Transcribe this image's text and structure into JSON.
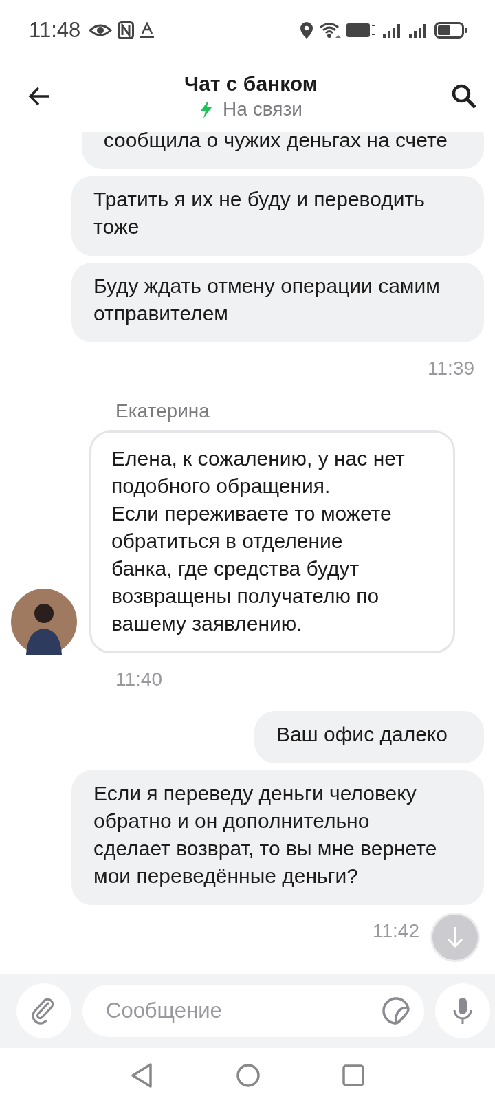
{
  "status_bar": {
    "time": "11:48"
  },
  "header": {
    "title": "Чат с банком",
    "status": "На связи"
  },
  "messages": [
    {
      "kind": "outgoing",
      "text": "сообщила о чужих деньгах на счете"
    },
    {
      "kind": "outgoing",
      "text": "Тратить я их не буду и переводить тоже"
    },
    {
      "kind": "outgoing",
      "text": "Буду ждать отмену операции самим отправителем"
    },
    {
      "kind": "time_out",
      "text": "11:39"
    },
    {
      "kind": "sender",
      "text": "Екатерина"
    },
    {
      "kind": "incoming",
      "text": "Елена, к сожалению, у нас нет подобного обращения.\nЕсли переживаете то можете обратиться в отделение банка, где средства будут возвращены получателю по вашему заявлению."
    },
    {
      "kind": "time_in",
      "text": "11:40"
    },
    {
      "kind": "outgoing",
      "text": "Ваш офис далеко"
    },
    {
      "kind": "outgoing",
      "text": "Если я переведу деньги человеку обратно и он дополнительно сделает возврат, то вы мне вернете мои переведённые деньги?"
    },
    {
      "kind": "time_out",
      "text": "11:42"
    }
  ],
  "composer": {
    "placeholder": "Сообщение"
  }
}
